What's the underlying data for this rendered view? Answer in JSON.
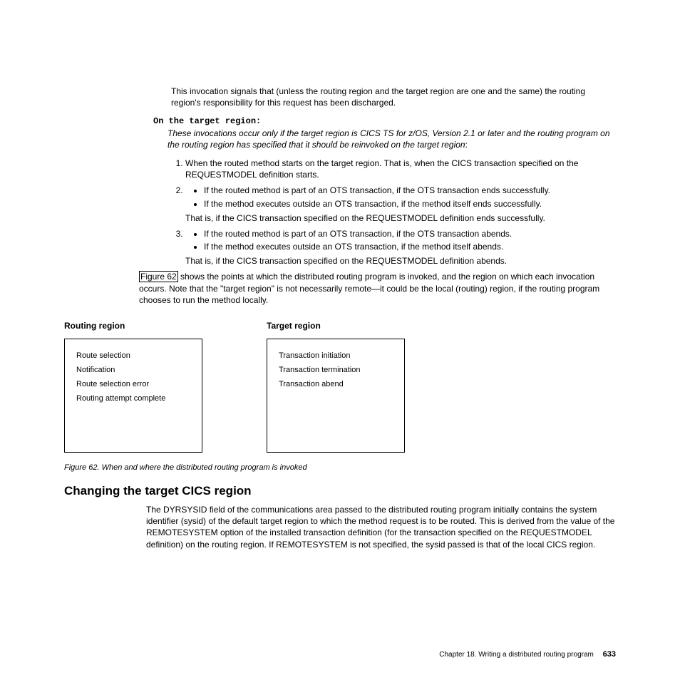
{
  "intro_para": "This invocation signals that (unless the routing region and the target region are one and the same) the routing region's responsibility for this request has been discharged.",
  "target_heading": "On the target region:",
  "target_intro_italic": "These invocations occur only if the target region is CICS TS for z/OS, Version 2.1 or later and the routing program on the routing region has specified that it should be reinvoked on the target region",
  "target_intro_colon": ":",
  "num1": "When the routed method starts on the target region. That is, when the CICS transaction specified on the REQUESTMODEL definition starts.",
  "num2_bullets": [
    "If the routed method is part of an OTS transaction, if the OTS transaction ends successfully.",
    "If the method executes outside an OTS transaction, if the method itself ends successfully."
  ],
  "num2_after": "That is, if the CICS transaction specified on the REQUESTMODEL definition ends successfully.",
  "num3_bullets": [
    "If the routed method is part of an OTS transaction, if the OTS transaction abends.",
    "If the method executes outside an OTS transaction, if the method itself abends."
  ],
  "num3_after": "That is, if the CICS transaction specified on the REQUESTMODEL definition abends.",
  "fig_ref": "Figure 62",
  "fig_sentence": " shows the points at which the distributed routing program is invoked, and the region on which each invocation occurs. Note that the \"target region\" is not necessarily remote—it could be the local (routing) region, if the routing program chooses to run the method locally.",
  "fig": {
    "left_title": "Routing region",
    "right_title": "Target region",
    "left_items": [
      "Route selection",
      "Notification",
      "Route selection error",
      "Routing attempt complete"
    ],
    "right_items": [
      "Transaction initiation",
      "Transaction termination",
      "Transaction abend"
    ],
    "caption": "Figure 62. When and where the distributed routing program is invoked"
  },
  "section_heading": "Changing the target CICS region",
  "section_para": "The DYRSYSID field of the communications area passed to the distributed routing program initially contains the system identifier (sysid) of the default target region to which the method request is to be routed. This is derived from the value of the REMOTESYSTEM option of the installed transaction definition (for the transaction specified on the REQUESTMODEL definition) on the routing region. If REMOTESYSTEM is not specified, the sysid passed is that of the local CICS region.",
  "footer_chapter": "Chapter 18. Writing a distributed routing program",
  "footer_page": "633"
}
